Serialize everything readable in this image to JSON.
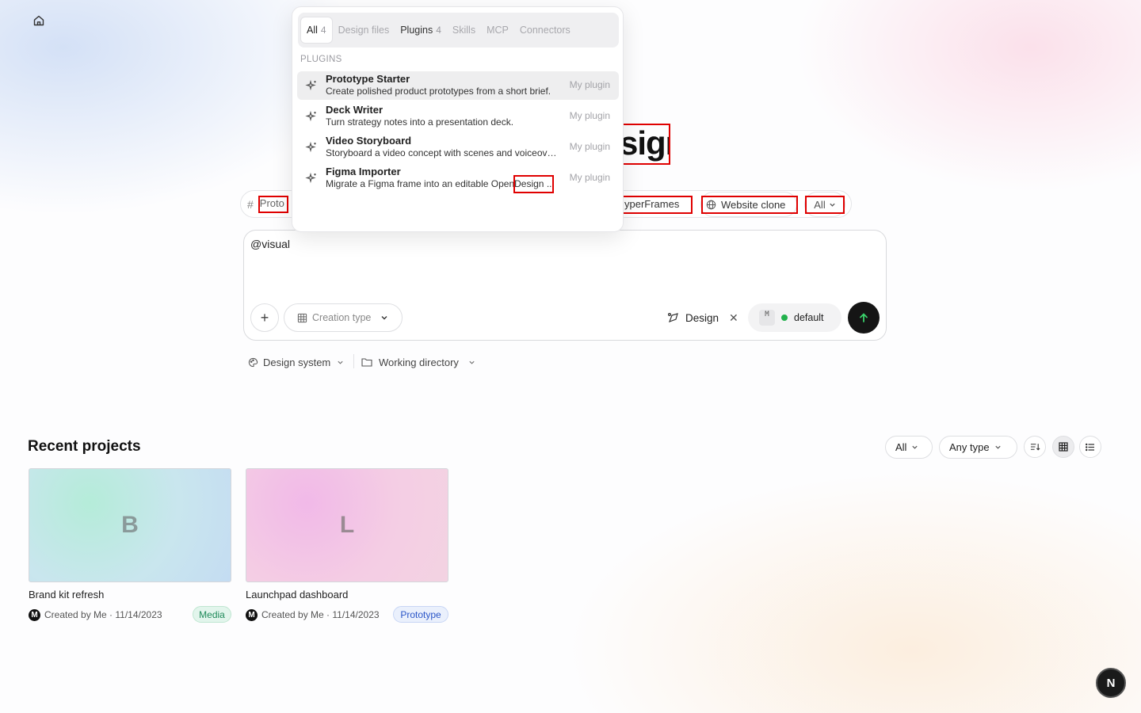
{
  "hero": {
    "title_fragment": "sign"
  },
  "chips": {
    "prototype_label": "Proto",
    "hyperframes_label": "yperFrames",
    "website_clone_label": "Website clone",
    "all_label": "All"
  },
  "composer": {
    "text": "@visual",
    "creation_type_label": "Creation type",
    "design_tag_label": "Design",
    "model_letter": "M",
    "model_label": "default"
  },
  "below_composer": {
    "design_system_label": "Design system",
    "working_directory_label": "Working directory"
  },
  "popover": {
    "tabs": [
      {
        "label": "All",
        "count": "4"
      },
      {
        "label": "Design files",
        "count": ""
      },
      {
        "label": "Plugins",
        "count": "4"
      },
      {
        "label": "Skills",
        "count": ""
      },
      {
        "label": "MCP",
        "count": ""
      },
      {
        "label": "Connectors",
        "count": ""
      }
    ],
    "section_label": "PLUGINS",
    "items": [
      {
        "name": "Prototype Starter",
        "desc": "Create polished product prototypes from a short brief.",
        "tag": "My plugin"
      },
      {
        "name": "Deck Writer",
        "desc": "Turn strategy notes into a presentation deck.",
        "tag": "My plugin"
      },
      {
        "name": "Video Storyboard",
        "desc": "Storyboard a video concept with scenes and voiceover.",
        "tag": "My plugin"
      },
      {
        "name": "Figma Importer",
        "desc": "Migrate a Figma frame into an editable OpenDesign ...",
        "tag": "My plugin"
      }
    ],
    "highlighted_word": "Design"
  },
  "recent": {
    "title": "Recent projects",
    "filter_all": "All",
    "filter_type": "Any type",
    "projects": [
      {
        "initial": "B",
        "name": "Brand kit refresh",
        "avatar": "M",
        "meta": "Created by Me · 11/14/2023",
        "badge": "Media"
      },
      {
        "initial": "L",
        "name": "Launchpad dashboard",
        "avatar": "M",
        "meta": "Created by Me · 11/14/2023",
        "badge": "Prototype"
      }
    ]
  },
  "corner_button": "N",
  "colors": {
    "accent_dark": "#151515",
    "status_green": "#22b14c",
    "highlight_red": "#e00000"
  }
}
